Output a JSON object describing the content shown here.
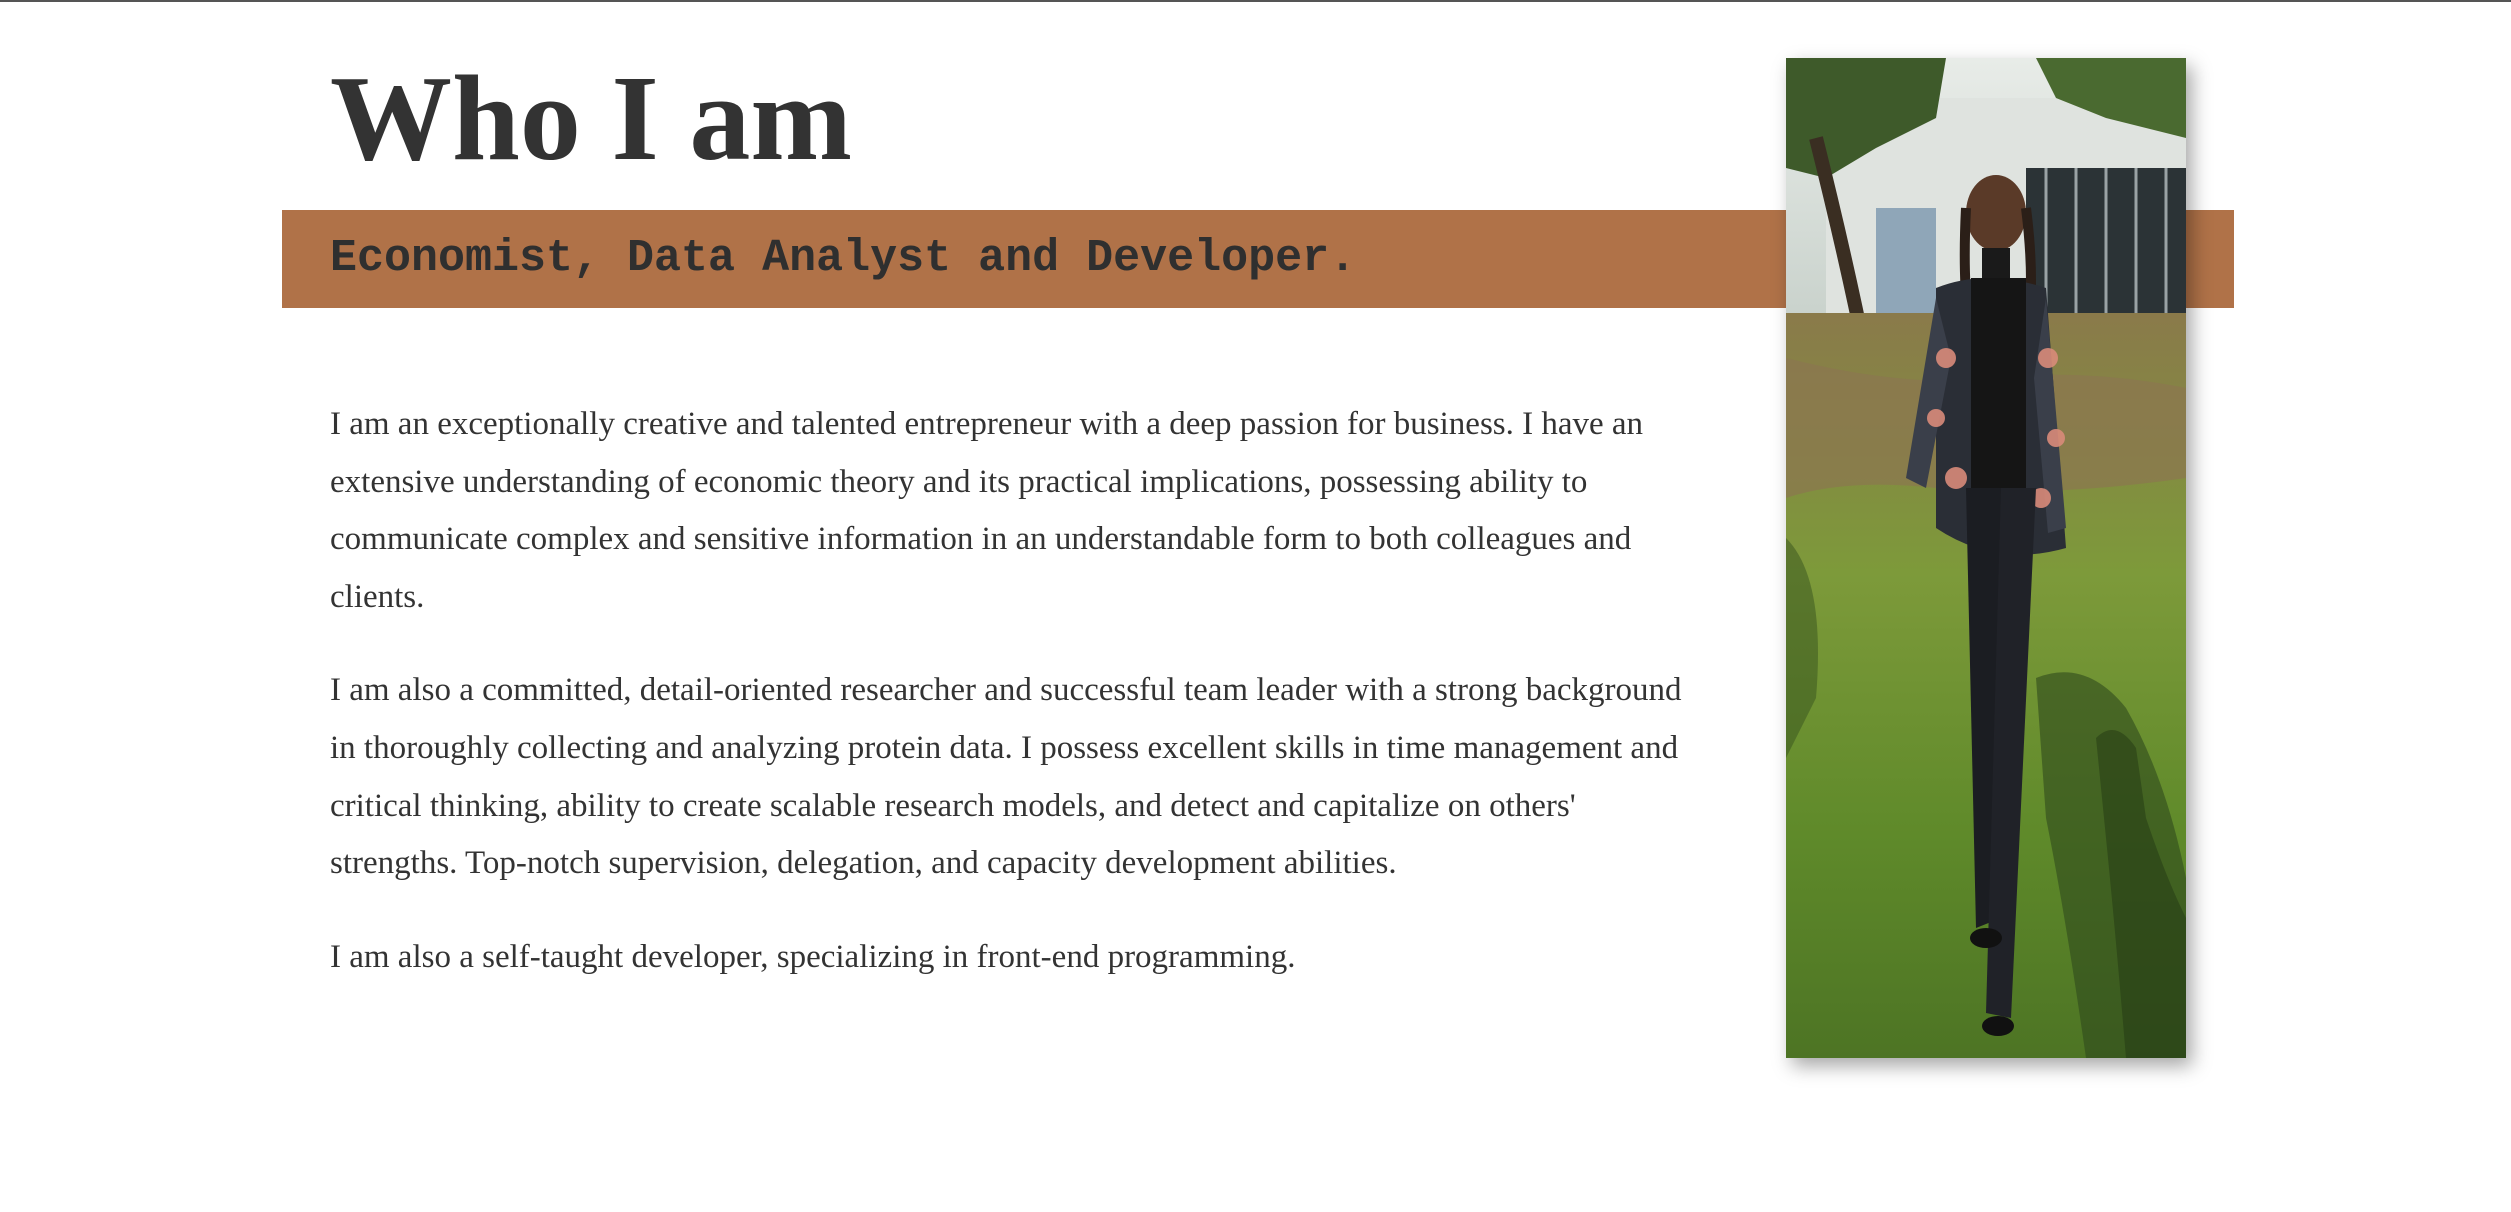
{
  "about": {
    "title": "Who I am",
    "tagline": "Economist, Data Analyst and Developer.",
    "paragraphs": [
      "I am an exceptionally creative and talented entrepreneur with a deep passion for business. I have an extensive understanding of economic theory and its practical implications, possessing ability to communicate complex and sensitive information in an understandable form to both colleagues and clients.",
      "I am also a committed, detail-oriented researcher and successful team leader with a strong background in thoroughly collecting and analyzing protein data. I possess excellent skills in time management and critical thinking, ability to create scalable research models, and detect and capitalize on others' strengths. Top-notch supervision, delegation, and capacity development abilities.",
      "I am also a self-taught developer, specializing in front-end programming."
    ]
  },
  "colors": {
    "accent_band": "#b07248",
    "text": "#333333",
    "background": "#ffffff"
  }
}
